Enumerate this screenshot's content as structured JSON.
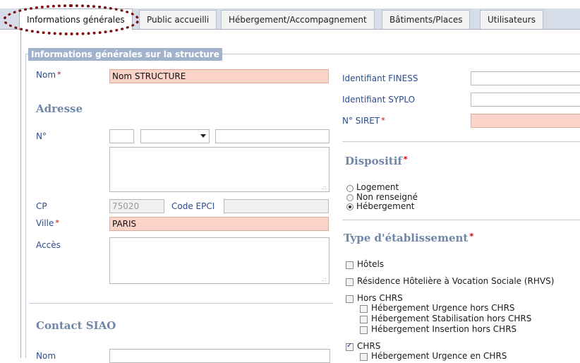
{
  "tabs": [
    {
      "label": "Informations générales",
      "active": true
    },
    {
      "label": "Public accueilli"
    },
    {
      "label": "Hébergement/Accompagnement"
    },
    {
      "label": "Bâtiments/Places"
    },
    {
      "label": "Utilisateurs"
    }
  ],
  "fieldset": {
    "legend": "Informations générales sur la structure"
  },
  "required_mark": "*",
  "left": {
    "nom": {
      "label": "Nom",
      "value": "Nom STRUCTURE"
    },
    "adresse_title": "Adresse",
    "numero": {
      "label": "N°",
      "value": "",
      "select_value": "",
      "street_value": ""
    },
    "cp": {
      "label": "CP",
      "value": "75020"
    },
    "code_epci": {
      "label": "Code EPCI",
      "value": ""
    },
    "ville": {
      "label": "Ville",
      "value": "PARIS"
    },
    "acces": {
      "label": "Accès",
      "value": ""
    },
    "contact_title": "Contact SIAO",
    "contact_nom": {
      "label": "Nom",
      "value": ""
    }
  },
  "right": {
    "finess": {
      "label": "Identifiant FINESS",
      "value": ""
    },
    "syplo": {
      "label": "Identifiant SYPLO",
      "value": ""
    },
    "siret": {
      "label": "N° SIRET",
      "value": ""
    },
    "dispositif": {
      "title": "Dispositif",
      "options": [
        {
          "label": "Logement",
          "checked": false
        },
        {
          "label": "Non renseigné",
          "checked": false
        },
        {
          "label": "Hébergement",
          "checked": true
        }
      ]
    },
    "type_etab": {
      "title": "Type d'établissement",
      "items": [
        {
          "label": "Hôtels",
          "checked": false
        },
        {
          "label": "Résidence Hôtelière à Vocation Sociale (RHVS)",
          "checked": false
        },
        {
          "label": "Hors CHRS",
          "checked": false
        },
        {
          "label": "Hébergement Urgence hors CHRS",
          "checked": false
        },
        {
          "label": "Hébergement Stabilisation hors CHRS",
          "checked": false
        },
        {
          "label": "Hébergement Insertion hors CHRS",
          "checked": false
        },
        {
          "label": "CHRS",
          "checked": true
        },
        {
          "label": "Hébergement Urgence en CHRS",
          "checked": false
        }
      ]
    }
  },
  "colors": {
    "required_bg": "#fad3c9",
    "label_blue": "#2b4c8c",
    "section_title": "#6f86a8",
    "legend_bg": "#a3b2cc",
    "highlight_ring": "#7a1010"
  }
}
